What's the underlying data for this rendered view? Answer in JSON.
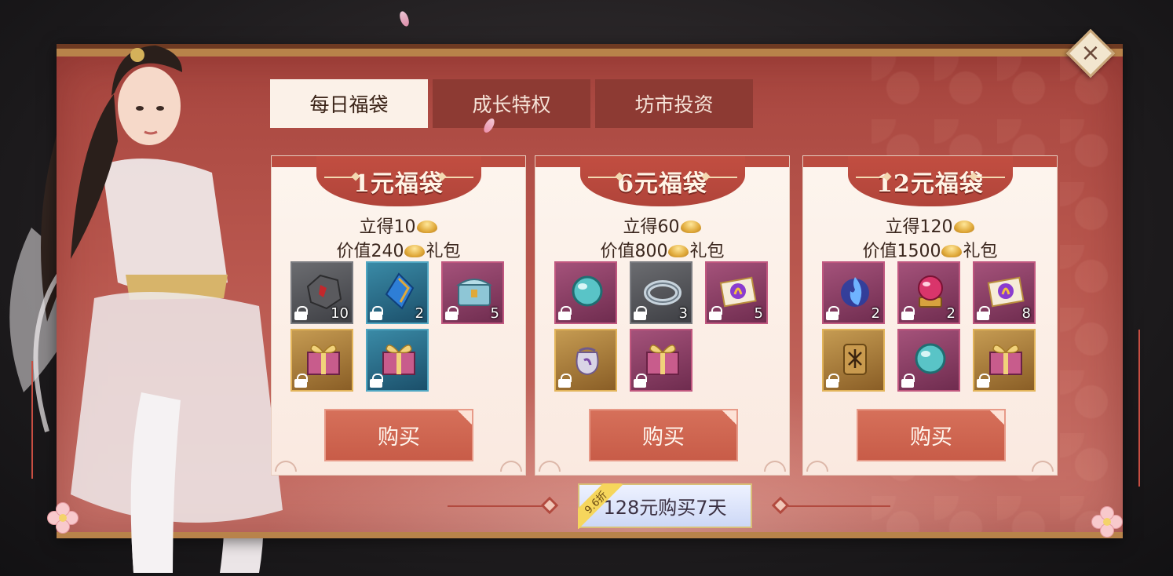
{
  "tabs": [
    {
      "label": "每日福袋",
      "active": true
    },
    {
      "label": "成长特权",
      "active": false
    },
    {
      "label": "坊市投资",
      "active": false
    }
  ],
  "packs": [
    {
      "title": "1元福袋",
      "instant_prefix": "立得10",
      "value_prefix": "价值240",
      "value_suffix": "礼包",
      "buy_label": "购买",
      "items": [
        {
          "icon": "ore-icon",
          "qty": "10",
          "bg": "gray"
        },
        {
          "icon": "blue-gem-icon",
          "qty": "2",
          "bg": "blue"
        },
        {
          "icon": "chest-icon",
          "qty": "5",
          "bg": "purple"
        },
        {
          "icon": "gift-box-icon",
          "qty": "",
          "bg": "gold"
        },
        {
          "icon": "gift-box-icon",
          "qty": "",
          "bg": "blue"
        }
      ]
    },
    {
      "title": "6元福袋",
      "instant_prefix": "立得60",
      "value_prefix": "价值800",
      "value_suffix": "礼包",
      "buy_label": "购买",
      "items": [
        {
          "icon": "orb-icon",
          "qty": "",
          "bg": "purple"
        },
        {
          "icon": "ring-icon",
          "qty": "3",
          "bg": "gray"
        },
        {
          "icon": "scroll-icon",
          "qty": "5",
          "bg": "purple"
        },
        {
          "icon": "pouch-icon",
          "qty": "",
          "bg": "gold"
        },
        {
          "icon": "gift-box-icon",
          "qty": "",
          "bg": "purple"
        }
      ]
    },
    {
      "title": "12元福袋",
      "instant_prefix": "立得120",
      "value_prefix": "价值1500",
      "value_suffix": "礼包",
      "buy_label": "购买",
      "items": [
        {
          "icon": "spirit-flame-icon",
          "qty": "2",
          "bg": "purple"
        },
        {
          "icon": "crystal-ball-icon",
          "qty": "2",
          "bg": "purple"
        },
        {
          "icon": "scroll-icon",
          "qty": "8",
          "bg": "purple"
        },
        {
          "icon": "token-icon",
          "qty": "",
          "bg": "gold"
        },
        {
          "icon": "orb-icon",
          "qty": "",
          "bg": "purple"
        },
        {
          "icon": "gift-box-icon",
          "qty": "",
          "bg": "gold"
        }
      ]
    }
  ],
  "weekly": {
    "label": "128元购买7天",
    "discount": "9.6折"
  },
  "close_icon": "×",
  "colors": {
    "panel": "#b9574e",
    "card": "#fdf5ee",
    "tab_active": "#fbf1e8",
    "tab_inactive": "#8d3a33",
    "buy_button": "#c85c48",
    "gold": "#e0a93a"
  }
}
